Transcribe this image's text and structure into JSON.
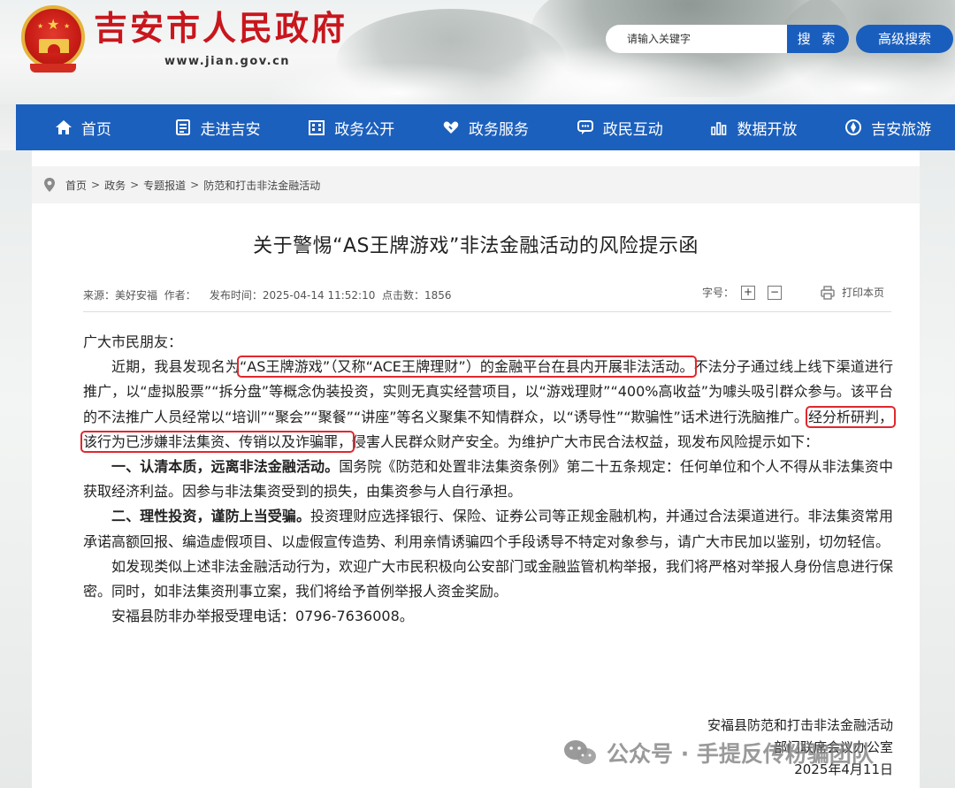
{
  "header": {
    "site_title": "吉安市人民政府",
    "site_url": "www.jian.gov.cn",
    "search_placeholder": "请输入关键字",
    "search_button": "搜 索",
    "advanced_search_button": "高级搜索"
  },
  "nav": {
    "items": [
      {
        "label": "首页",
        "icon": "home-icon"
      },
      {
        "label": "走进吉安",
        "icon": "book-icon"
      },
      {
        "label": "政务公开",
        "icon": "building-icon"
      },
      {
        "label": "政务服务",
        "icon": "heart-hand-icon"
      },
      {
        "label": "政民互动",
        "icon": "chat-icon"
      },
      {
        "label": "数据开放",
        "icon": "bar-chart-icon"
      },
      {
        "label": "吉安旅游",
        "icon": "compass-icon"
      }
    ]
  },
  "breadcrumb": {
    "items": [
      "首页",
      "政务",
      "专题报道",
      "防范和打击非法金融活动"
    ],
    "separator": ">"
  },
  "article": {
    "title": "关于警惕“AS王牌游戏”非法金融活动的风险提示函",
    "meta": "来源：美好安福  作者：    发布时间：2025-04-14 11:52:10  点击数：1856",
    "font_size_label": "字号：",
    "font_plus": "+",
    "font_minus": "−",
    "print_label": "打印本页",
    "greeting": "广大市民朋友：",
    "p1_a": "近期，我县发现名为",
    "p1_hl1": "“AS王牌游戏”（又称“ACE王牌理财”）的金融平台在县内开展非法活动。",
    "p1_b": "不法分子通过线上线下渠道进行推广，以“虚拟股票”“拆分盘”等概念伪装投资，实则无真实经营项目，以“游戏理财”“400%高收益”为噱头吸引群众参与。该平台的不法推广人员经常以“培训”“聚会”“聚餐”“讲座”等名义聚集不知情群众，以“诱导性”“欺骗性”话术进行洗脑推广。",
    "p1_hl2": "经分析研判，该行为已涉嫌非法集资、传销以及诈骗罪，",
    "p1_c": "侵害人民群众财产安全。为维护广大市民合法权益，现发布风险提示如下：",
    "p2_bold": "一、认清本质，远离非法金融活动。",
    "p2_text": "国务院《防范和处置非法集资条例》第二十五条规定：任何单位和个人不得从非法集资中获取经济利益。因参与非法集资受到的损失，由集资参与人自行承担。",
    "p3_bold": "二、理性投资，谨防上当受骗。",
    "p3_text": "投资理财应选择银行、保险、证券公司等正规金融机构，并通过合法渠道进行。非法集资常用承诺高额回报、编造虚假项目、以虚假宣传造势、利用亲情诱骗四个手段诱导不特定对象参与，请广大市民加以鉴别，切勿轻信。",
    "p4": "如发现类似上述非法金融活动行为，欢迎广大市民积极向公安部门或金融监管机构举报，我们将严格对举报人身份信息进行保密。同时，如非法集资刑事立案，我们将给予首例举报人资金奖励。",
    "p5": "安福县防非办举报受理电话：0796-7636008。",
    "sign_line1": "安福县防范和打击非法金融活动",
    "sign_line2": "部门联席会议办公室",
    "sign_date": "2025年4月11日"
  },
  "watermark": {
    "text": "公众号 · 手提反传粉骗团队",
    "icon": "wechat-icon"
  },
  "colors": {
    "brand_red": "#c8161d",
    "nav_blue": "#1c60bd",
    "highlight_red": "#e0282e"
  }
}
